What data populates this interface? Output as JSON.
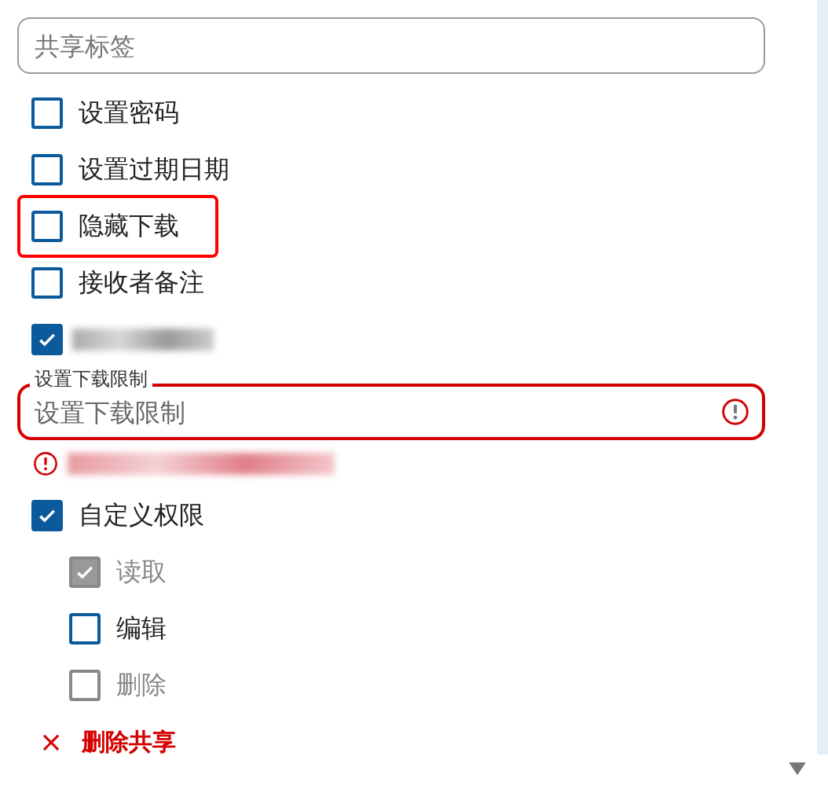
{
  "share_label": {
    "placeholder": "共享标签"
  },
  "options": [
    {
      "label": "设置密码",
      "checked": false,
      "highlighted": false
    },
    {
      "label": "设置过期日期",
      "checked": false,
      "highlighted": false
    },
    {
      "label": "隐藏下载",
      "checked": false,
      "highlighted": true
    },
    {
      "label": "接收者备注",
      "checked": false,
      "highlighted": false
    },
    {
      "checked": true,
      "highlighted": false,
      "blurred": true
    }
  ],
  "download_limit": {
    "label": "设置下载限制",
    "placeholder": "设置下载限制",
    "error": true
  },
  "custom_permissions": {
    "label": "自定义权限",
    "checked": true,
    "children": [
      {
        "label": "读取",
        "checked": true,
        "disabled": true
      },
      {
        "label": "编辑",
        "checked": false,
        "disabled": false
      },
      {
        "label": "删除",
        "checked": false,
        "disabled": true
      }
    ]
  },
  "delete_share": {
    "icon": "×",
    "label": "删除共享"
  }
}
